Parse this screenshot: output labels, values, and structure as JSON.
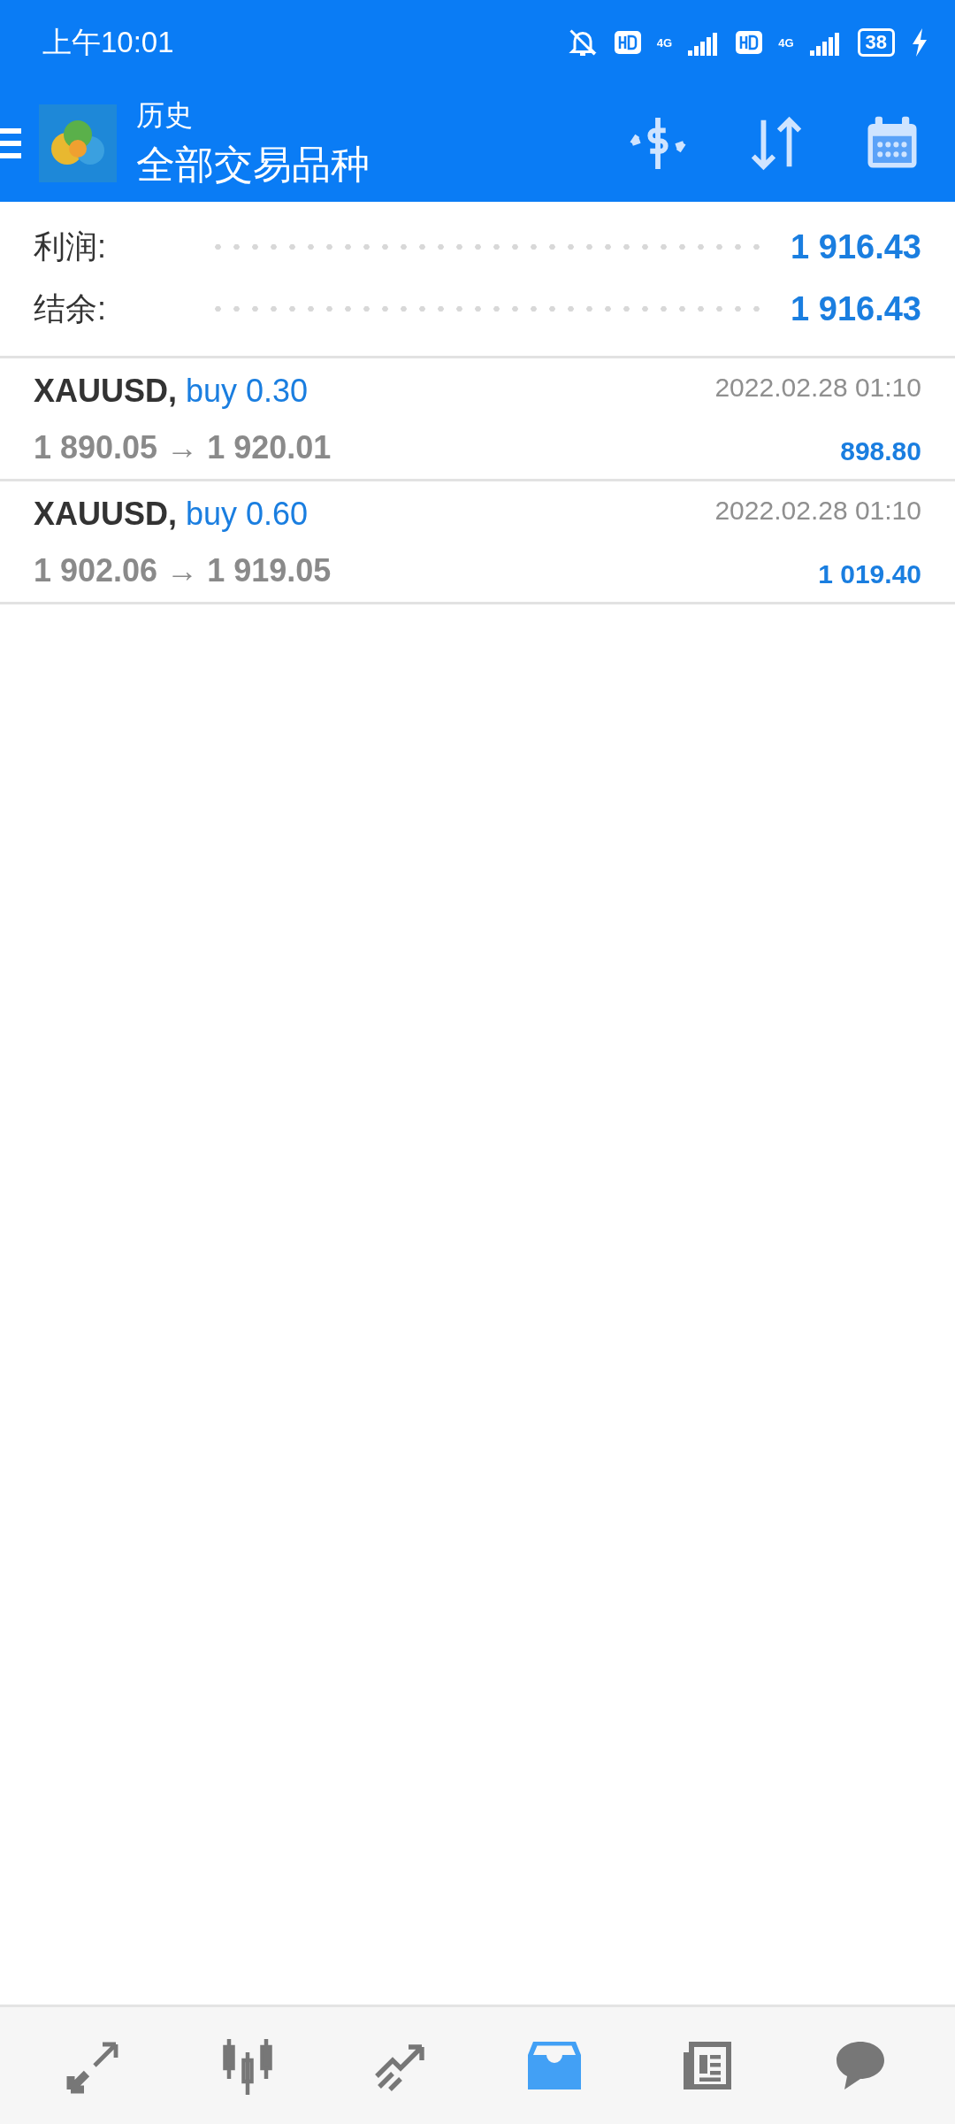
{
  "status_bar": {
    "time": "上午10:01",
    "battery": "38",
    "network_1": "4G",
    "network_2": "4G"
  },
  "header": {
    "title": "历史",
    "subtitle": "全部交易品种"
  },
  "summary": [
    {
      "label": "利润:",
      "value": "1 916.43"
    },
    {
      "label": "结余:",
      "value": "1 916.43"
    }
  ],
  "trades": [
    {
      "symbol": "XAUUSD,",
      "side": "buy 0.30",
      "prices": "1 890.05 → 1 920.01",
      "time": "2022.02.28 01:10",
      "profit": "898.80"
    },
    {
      "symbol": "XAUUSD,",
      "side": "buy 0.60",
      "prices": "1 902.06 → 1 919.05",
      "time": "2022.02.28 01:10",
      "profit": "1 019.40"
    }
  ],
  "nav": [
    {
      "kind": "quotes",
      "selected": false
    },
    {
      "kind": "chart",
      "selected": false
    },
    {
      "kind": "trade",
      "selected": false
    },
    {
      "kind": "history",
      "selected": true
    },
    {
      "kind": "news",
      "selected": false
    },
    {
      "kind": "chat",
      "selected": false
    }
  ]
}
